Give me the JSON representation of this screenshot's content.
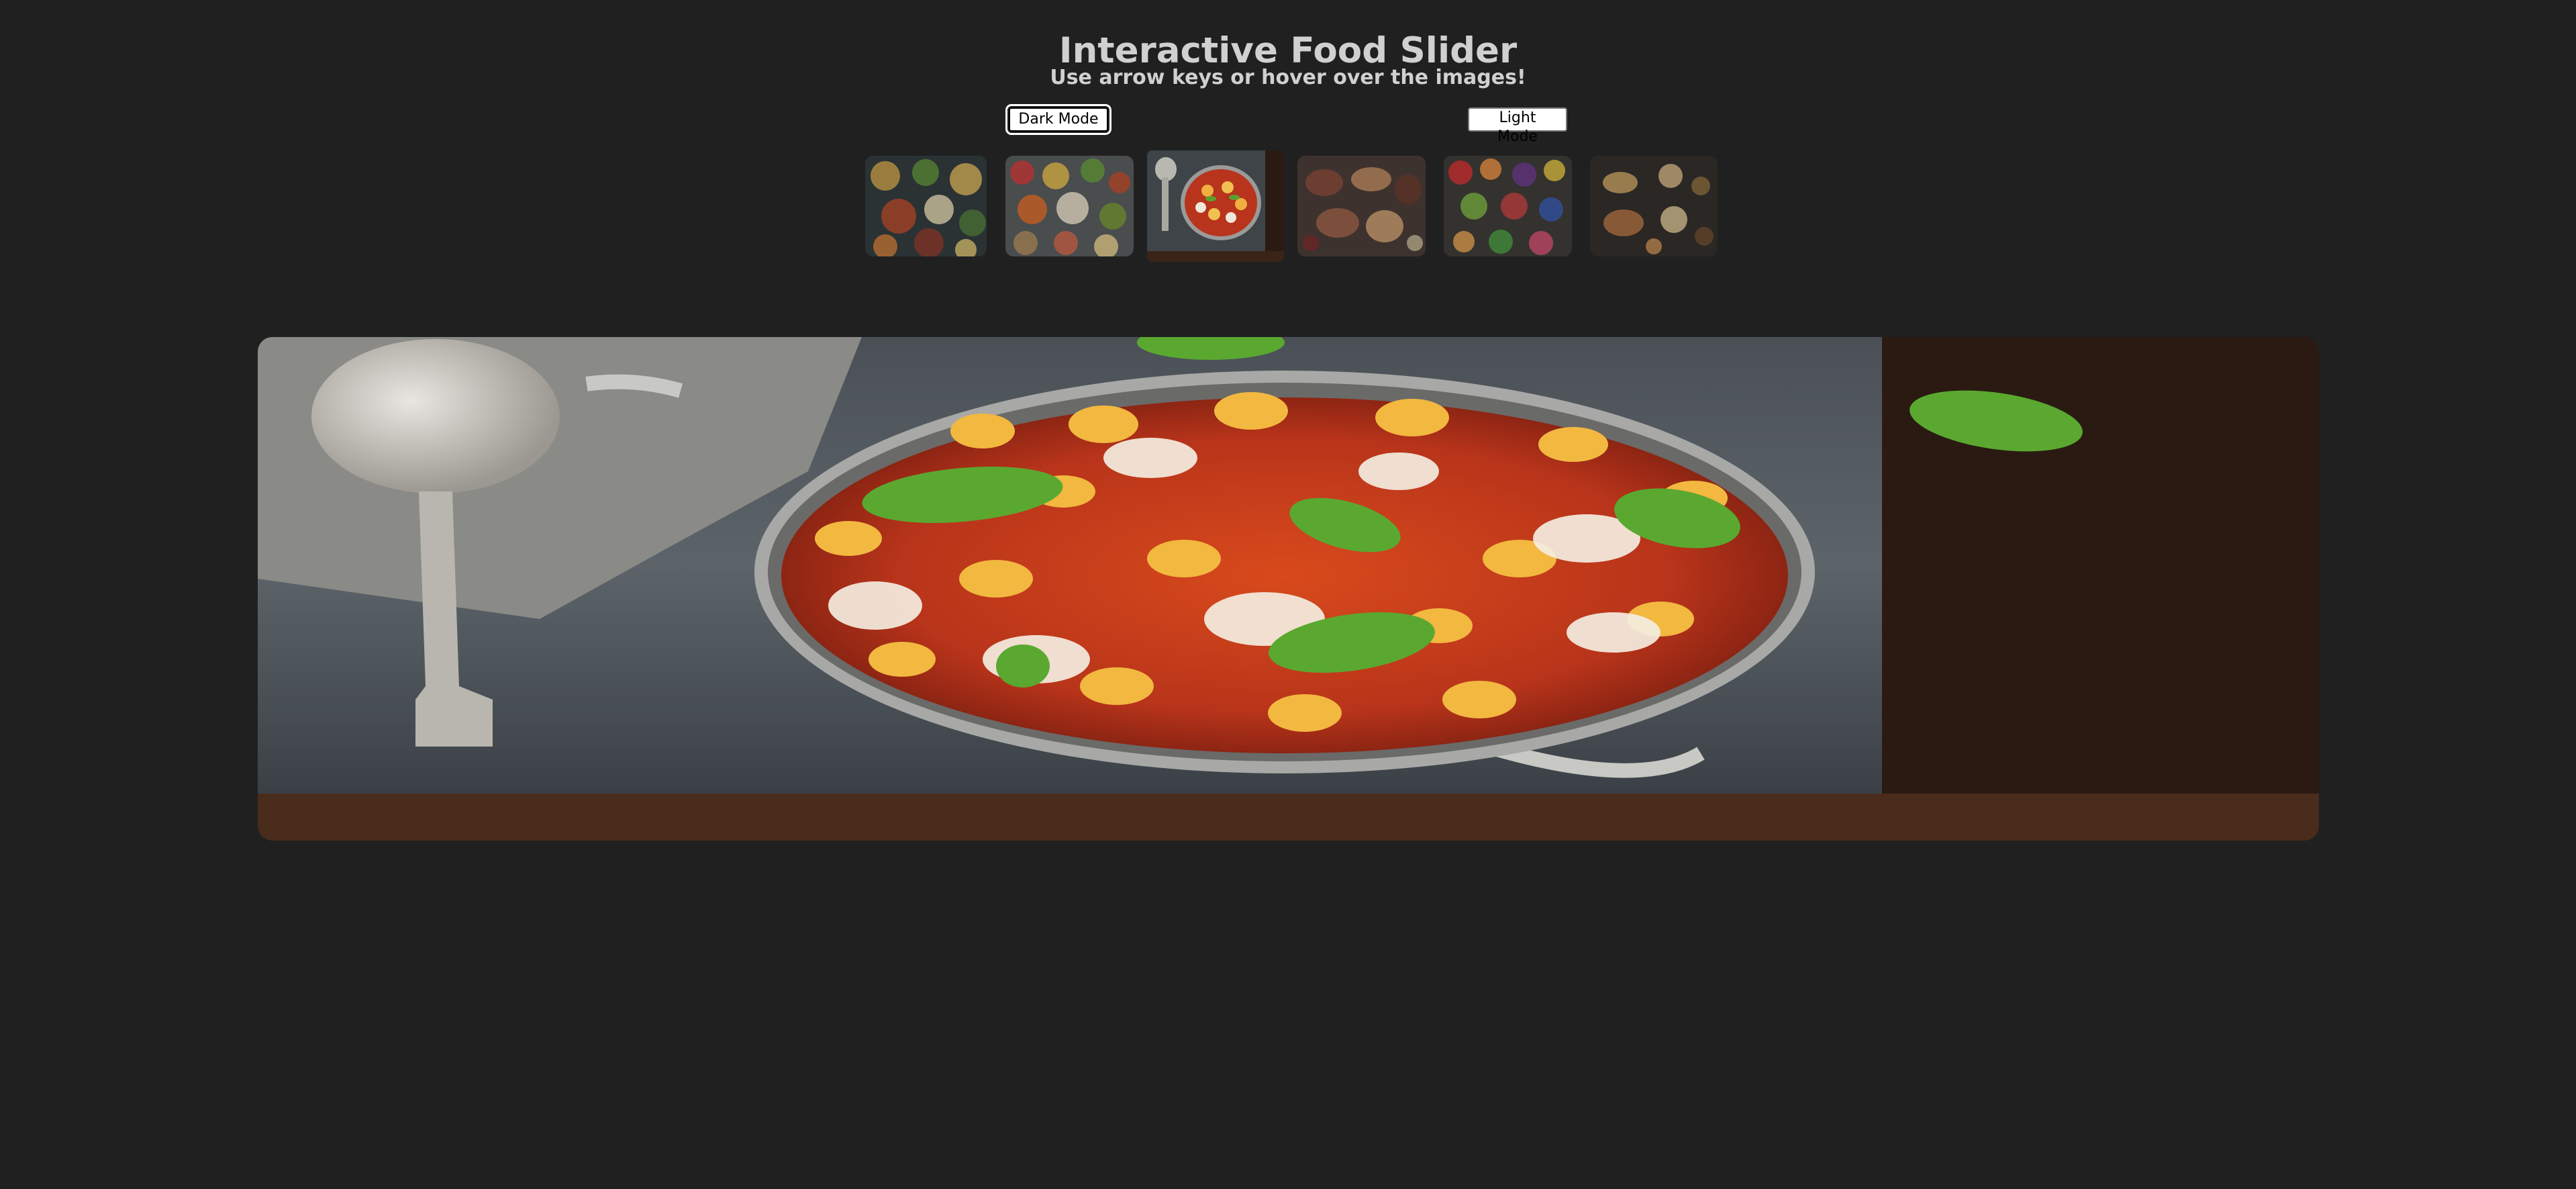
{
  "page": {
    "title": "Interactive Food Slider",
    "subtitle": "Use arrow keys or hover over the images!"
  },
  "controls": {
    "dark_mode_label": "Dark Mode",
    "light_mode_label": "Light Mode"
  },
  "theme": {
    "background": "#202020",
    "text": "#d0d0d0"
  },
  "slider": {
    "active_index": 2,
    "thumbnails": [
      {
        "name": "food-spread-bowls"
      },
      {
        "name": "colorful-bowls-table"
      },
      {
        "name": "gnocchi-skillet"
      },
      {
        "name": "charcuterie-board"
      },
      {
        "name": "fresh-produce-spread"
      },
      {
        "name": "dumplings-and-sauces"
      }
    ],
    "main_image": {
      "name": "gnocchi-skillet"
    }
  }
}
